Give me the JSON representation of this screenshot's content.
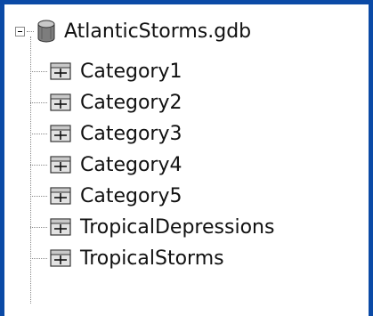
{
  "root": {
    "label": "AtlanticStorms.gdb",
    "icon": "geodatabase-icon",
    "expanded": true
  },
  "children": [
    {
      "label": "Category1",
      "icon": "feature-class-icon"
    },
    {
      "label": "Category2",
      "icon": "feature-class-icon"
    },
    {
      "label": "Category3",
      "icon": "feature-class-icon"
    },
    {
      "label": "Category4",
      "icon": "feature-class-icon"
    },
    {
      "label": "Category5",
      "icon": "feature-class-icon"
    },
    {
      "label": "TropicalDepressions",
      "icon": "feature-class-icon"
    },
    {
      "label": "TropicalStorms",
      "icon": "feature-class-icon"
    }
  ],
  "colors": {
    "frame": "#0b4aa6",
    "panel": "#ffffff",
    "text": "#111111"
  }
}
